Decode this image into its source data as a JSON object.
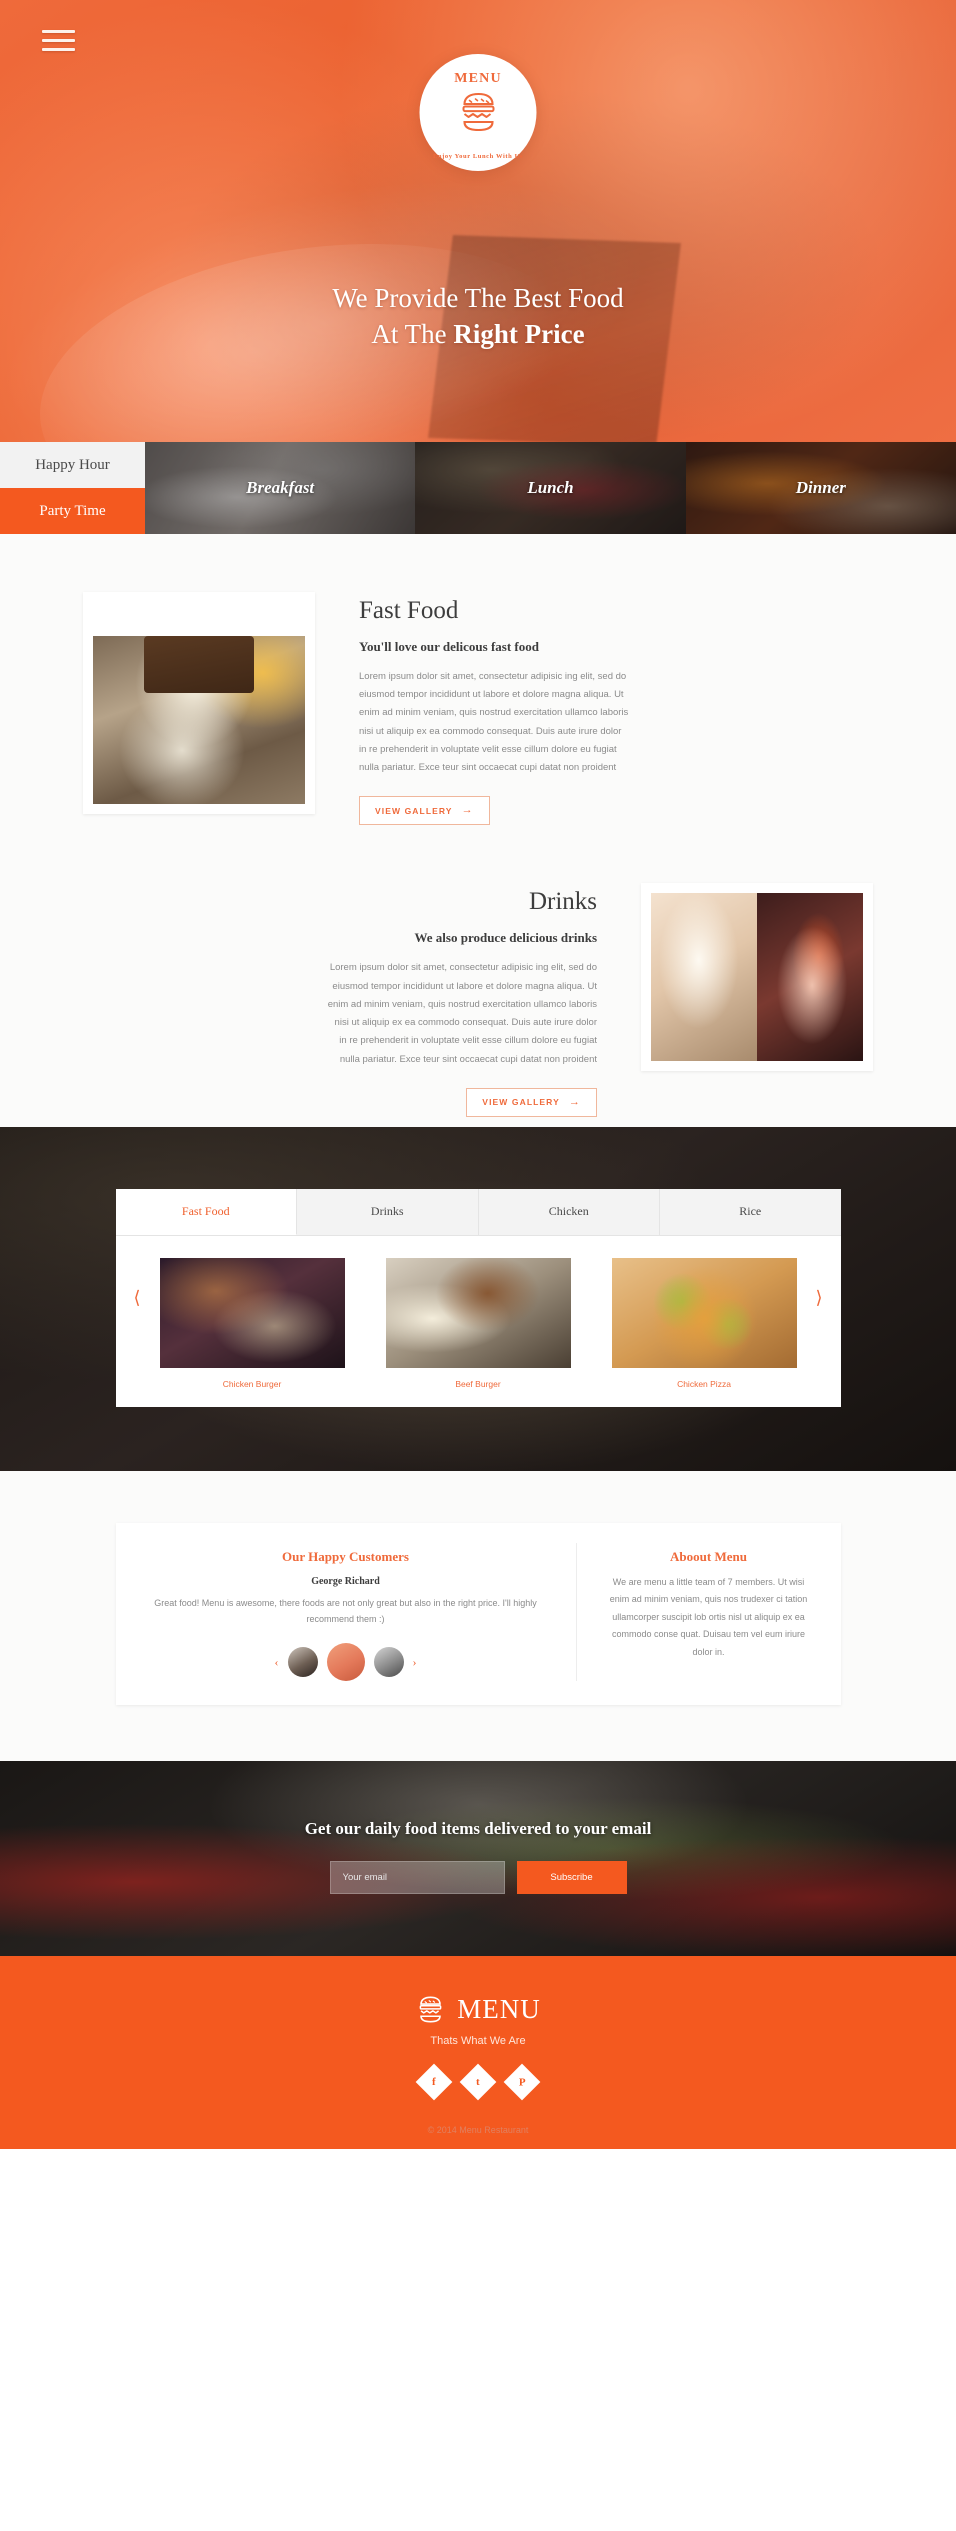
{
  "theme": {
    "accent": "#f4591f",
    "accent_soft": "#ef6a3b",
    "dark": "#1c1715",
    "page_bg": "#fbfbfa"
  },
  "hero": {
    "menu_icon": "hamburger-menu-icon",
    "logo": {
      "title": "MENU",
      "mark": "burger-icon",
      "arc_text": "Enjoy Your Lunch With Us"
    },
    "headline_line1": "We Provide The Best Food",
    "headline_line2_prefix": "At The ",
    "headline_line2_strong": "Right Price"
  },
  "meal_tabs": {
    "side": [
      {
        "label": "Happy Hour",
        "active": false
      },
      {
        "label": "Party Time",
        "active": true
      }
    ],
    "images": [
      {
        "label": "Breakfast"
      },
      {
        "label": "Lunch"
      },
      {
        "label": "Dinner"
      }
    ]
  },
  "features": [
    {
      "title": "Fast Food",
      "subtitle": "You'll love our delicous fast food",
      "body": "Lorem ipsum dolor sit amet, consectetur adipisic ing elit, sed do eiusmod tempor incididunt ut labore et dolore magna aliqua. Ut enim ad minim veniam, quis nostrud exercitation ullamco laboris nisi ut aliquip ex ea commodo consequat. Duis aute irure dolor in re prehenderit in voluptate velit esse cillum dolore eu fugiat nulla pariatur. Exce teur sint occaecat cupi datat non proident",
      "cta": "VIEW GALLERY",
      "cta_icon": "arrow-right-icon",
      "image_alt": "dessert-plate-photo"
    },
    {
      "title": "Drinks",
      "subtitle": "We also produce delicious drinks",
      "body": "Lorem ipsum dolor sit amet, consectetur adipisic ing elit, sed do eiusmod tempor incididunt ut labore et dolore magna aliqua. Ut enim ad minim veniam, quis nostrud exercitation ullamco laboris nisi ut aliquip ex ea commodo consequat. Duis aute irure dolor in re prehenderit in voluptate velit esse cillum dolore eu fugiat nulla pariatur. Exce teur sint occaecat cupi datat non proident",
      "cta": "VIEW GALLERY",
      "cta_icon": "arrow-right-icon",
      "image_alt": "cocktail-glasses-photo"
    }
  ],
  "gallery": {
    "tabs": [
      {
        "label": "Fast Food",
        "active": true
      },
      {
        "label": "Drinks",
        "active": false
      },
      {
        "label": "Chicken",
        "active": false
      },
      {
        "label": "Rice",
        "active": false
      }
    ],
    "prev_icon": "chevron-left-icon",
    "next_icon": "chevron-right-icon",
    "items": [
      {
        "caption": "Chicken Burger"
      },
      {
        "caption": "Beef Burger"
      },
      {
        "caption": "Chicken Pizza"
      }
    ]
  },
  "testimonials": {
    "title": "Our Happy Customers",
    "author": "George Richard",
    "quote": "Great food! Menu is awesome, there foods are not only great but also in the right price. I'll highly recommend them :)",
    "prev_icon": "chevron-left-icon",
    "next_icon": "chevron-right-icon",
    "avatars": [
      {
        "name": "avatar-woman",
        "active": false
      },
      {
        "name": "avatar-man-active",
        "active": true
      },
      {
        "name": "avatar-man",
        "active": false
      }
    ]
  },
  "about": {
    "title": "Aboout Menu",
    "body": "We are menu a little team of 7 members. Ut wisi enim ad minim veniam, quis nos trudexer ci tation ullamcorper suscipit lob ortis nisl ut aliquip ex ea commodo conse quat. Duisau tem vel eum iriure dolor in."
  },
  "subscribe": {
    "title": "Get our daily food items delivered to your email",
    "input_value": "",
    "input_placeholder": "Your email",
    "button": "Subscribe"
  },
  "footer": {
    "logo_mark": "burger-icon",
    "logo_text": "MENU",
    "tagline": "Thats What We Are",
    "socials": [
      {
        "name": "facebook-icon",
        "glyph": "f"
      },
      {
        "name": "twitter-icon",
        "glyph": "t"
      },
      {
        "name": "pinterest-icon",
        "glyph": "P"
      }
    ],
    "copyright": "© 2014 Menu Restaurant"
  }
}
